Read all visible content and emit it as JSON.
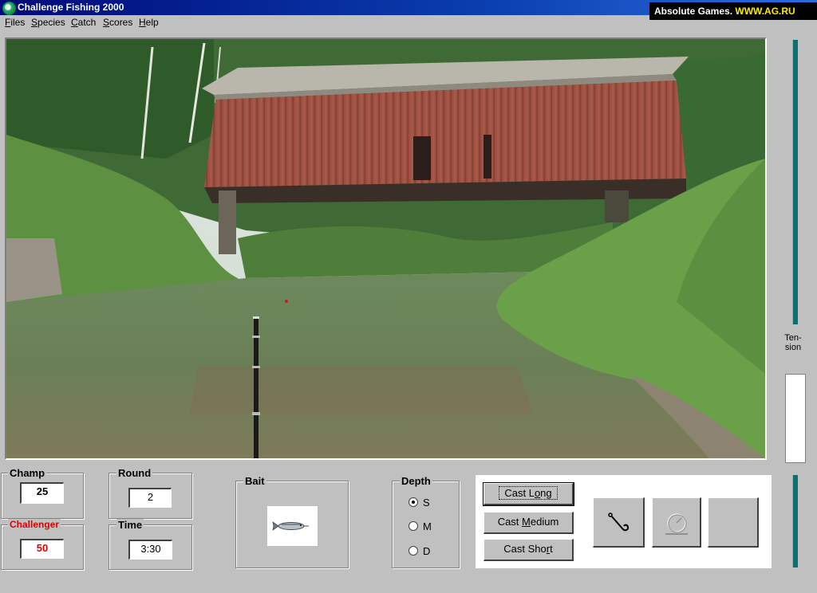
{
  "window": {
    "title": "Challenge Fishing 2000"
  },
  "brand": {
    "name": "Absolute Games. ",
    "url": "WWW.AG.RU"
  },
  "menu": [
    "Files",
    "Species",
    "Catch",
    "Scores",
    "Help"
  ],
  "scores": {
    "champ_label": "Champ",
    "champ_value": "25",
    "challenger_label": "Challenger",
    "challenger_value": "50",
    "round_label": "Round",
    "round_value": "2",
    "time_label": "Time",
    "time_value": "3:30"
  },
  "bait": {
    "label": "Bait",
    "icon": "minnow-bait-icon"
  },
  "depth": {
    "label": "Depth",
    "options": [
      "S",
      "M",
      "D"
    ],
    "selected": "S"
  },
  "cast": {
    "long": {
      "pre": "Cast L",
      "key": "o",
      "post": "ng"
    },
    "medium": {
      "pre": "Cast ",
      "key": "M",
      "post": "edium"
    },
    "short": {
      "pre": "Cast Sho",
      "key": "r",
      "post": "t"
    }
  },
  "tools": [
    "hook-icon",
    "reel-icon",
    "blank"
  ],
  "tension": {
    "label_line1": "Ten-",
    "label_line2": "sion",
    "level": 0
  },
  "colors": {
    "title_bar": "#0a3fb0",
    "challenger": "#e00000",
    "tension": "#0e6f6f"
  }
}
